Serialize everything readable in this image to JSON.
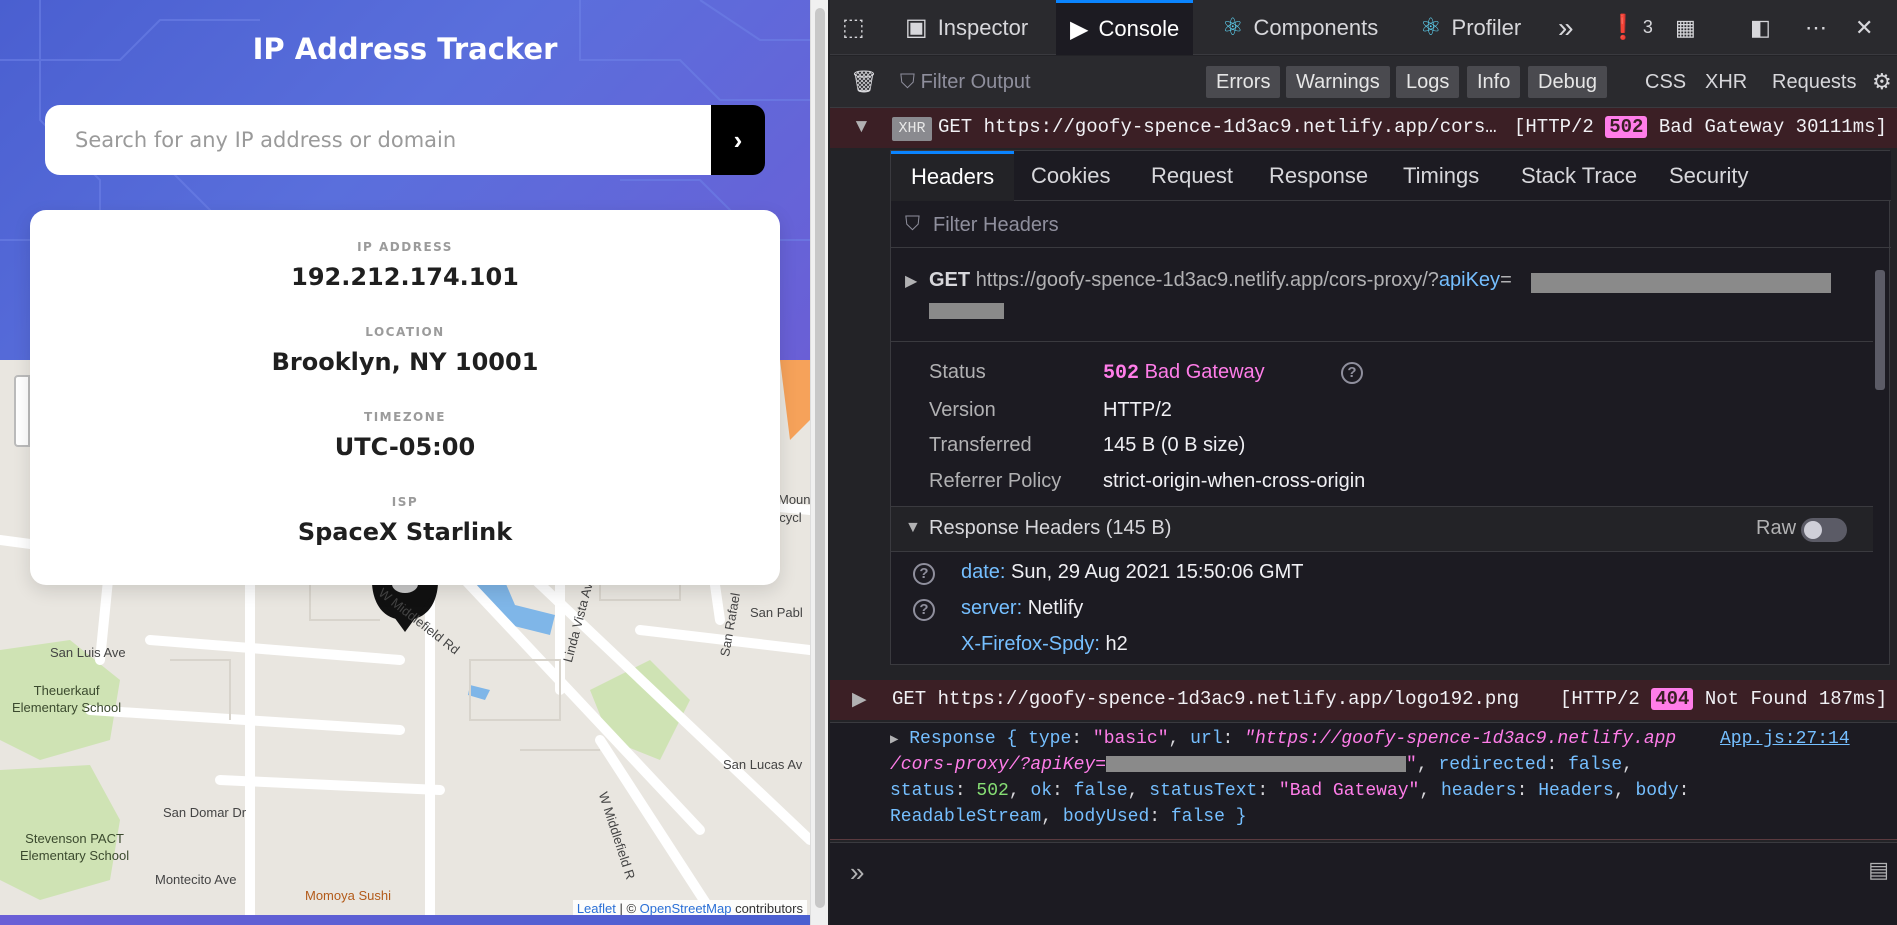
{
  "app": {
    "title": "IP Address Tracker",
    "search": {
      "placeholder": "Search for any IP address or domain",
      "button_glyph": "›"
    },
    "info": [
      {
        "label": "IP ADDRESS",
        "value": "192.212.174.101"
      },
      {
        "label": "LOCATION",
        "value": "Brooklyn, NY 10001"
      },
      {
        "label": "TIMEZONE",
        "value": "UTC-05:00"
      },
      {
        "label": "ISP",
        "value": "SpaceX Starlink"
      }
    ],
    "map": {
      "labels": {
        "san_luis": "San Luis Ave",
        "theuerkauf_1": "Theuerkauf",
        "theuerkauf_2": "Elementary School",
        "san_domar": "San Domar Dr",
        "stevenson_1": "Stevenson PACT",
        "stevenson_2": "Elementary School",
        "montecito": "Montecito Ave",
        "momoya": "Momoya Sushi",
        "middlefield_top": "W Middlefield Rd",
        "middlefield_bottom": "W Middlefield R",
        "linda_vista": "Linda Vista Av",
        "san_rafael": "San Rafael",
        "san_pablo": "San Pabl",
        "san_lucas": "San Lucas Av",
        "mount": "Moun",
        "cycle": "ecycl"
      },
      "attribution": {
        "leaflet": "Leaflet",
        "sep": " | © ",
        "osm": "OpenStreetMap",
        "suffix": " contributors"
      }
    }
  },
  "devtools": {
    "tabs": [
      "Inspector",
      "Console",
      "Components",
      "Profiler"
    ],
    "error_count": "3",
    "filter_placeholder": "Filter Output",
    "levels": [
      "Errors",
      "Warnings",
      "Logs",
      "Info",
      "Debug"
    ],
    "extra_filters": [
      "CSS",
      "XHR",
      "Requests"
    ],
    "request1": {
      "badge": "XHR",
      "method": "GET",
      "url": "https://goofy-spence-1d3ac9.netlify.app/cors…",
      "proto": "[HTTP/2",
      "code": "502",
      "status": "Bad Gateway 30111ms]"
    },
    "detail_tabs": [
      "Headers",
      "Cookies",
      "Request",
      "Response",
      "Timings",
      "Stack Trace",
      "Security"
    ],
    "filter_headers": "Filter Headers",
    "summary": {
      "method": "GET",
      "url": "https://goofy-spence-1d3ac9.netlify.app/cors-proxy/?",
      "param": "apiKey",
      "eq": "="
    },
    "fields": {
      "status_label": "Status",
      "status_code": "502",
      "status_text": "Bad Gateway",
      "version_label": "Version",
      "version_value": "HTTP/2",
      "transferred_label": "Transferred",
      "transferred_value": "145 B (0 B size)",
      "referrer_label": "Referrer Policy",
      "referrer_value": "strict-origin-when-cross-origin"
    },
    "response_headers": {
      "title": "Response Headers (145 B)",
      "raw": "Raw",
      "items": [
        {
          "name": "date:",
          "value": "Sun, 29 Aug 2021 15:50:06 GMT"
        },
        {
          "name": "server:",
          "value": "Netlify"
        },
        {
          "name": "X-Firefox-Spdy:",
          "value": "h2"
        }
      ]
    },
    "request2": {
      "method": "GET",
      "url": "https://goofy-spence-1d3ac9.netlify.app/logo192.png",
      "proto": "[HTTP/2",
      "code": "404",
      "status": "Not Found 187ms]"
    },
    "log": {
      "source": "App.js:27:14",
      "line1_a": "Response { ",
      "type_k": "type",
      "type_v": "\"basic\"",
      "url_k": "url",
      "url_v": "\"https://goofy-spence-1d3ac9.netlify.app",
      "line2_url": "/cors-proxy/?apiKey=",
      "line2_end": "\"",
      "redirected_k": "redirected",
      "redirected_v": "false",
      "status_k": "status",
      "status_v": "502",
      "ok_k": "ok",
      "ok_v": "false",
      "statusText_k": "statusText",
      "statusText_v": "\"Bad Gateway\"",
      "headers_k": "headers",
      "headers_v": "Headers",
      "body_k": "body",
      "body_v": "ReadableStream",
      "bodyUsed_k": "bodyUsed",
      "bodyUsed_v": "false",
      "close": " }"
    },
    "prompt": "»"
  }
}
